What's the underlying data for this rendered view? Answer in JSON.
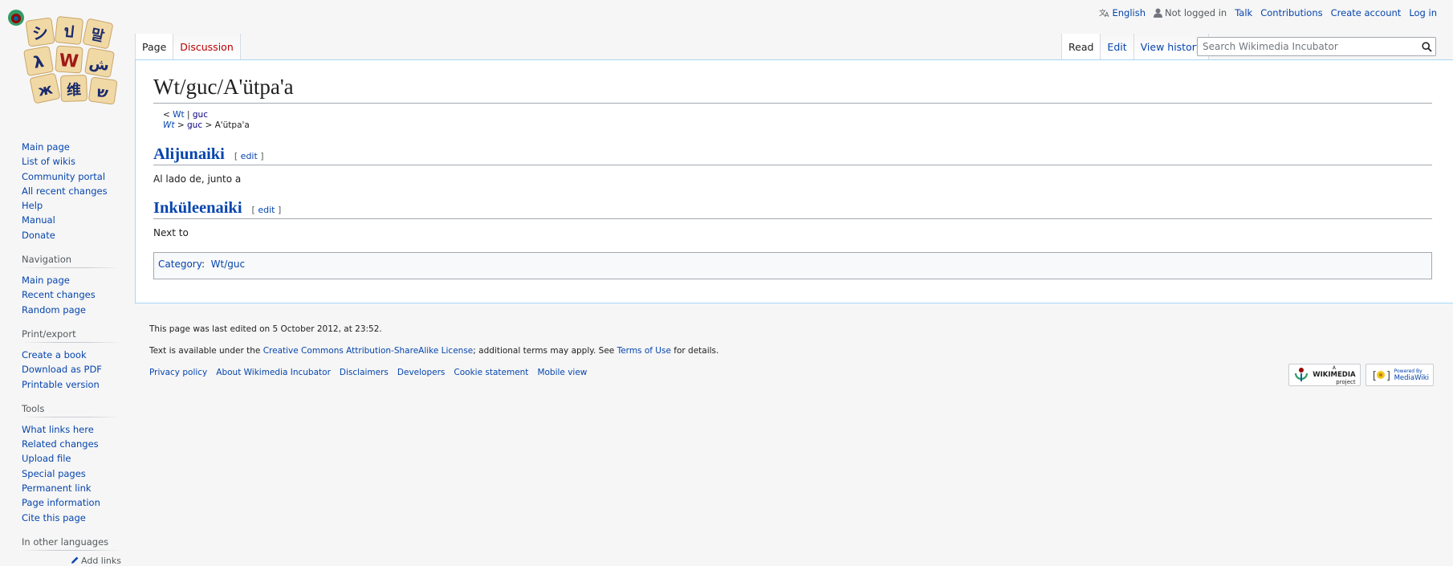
{
  "personal": {
    "language": "English",
    "not_logged_in": "Not logged in",
    "talk": "Talk",
    "contributions": "Contributions",
    "create_account": "Create account",
    "log_in": "Log in"
  },
  "tabs": {
    "page": "Page",
    "discussion": "Discussion",
    "read": "Read",
    "edit": "Edit",
    "view_history": "View history"
  },
  "search": {
    "placeholder": "Search Wikimedia Incubator"
  },
  "sidebar": {
    "main": [
      "Main page",
      "List of wikis",
      "Community portal",
      "All recent changes",
      "Help",
      "Manual",
      "Donate"
    ],
    "navigation": {
      "heading": "Navigation",
      "items": [
        "Main page",
        "Recent changes",
        "Random page"
      ]
    },
    "print": {
      "heading": "Print/export",
      "items": [
        "Create a book",
        "Download as PDF",
        "Printable version"
      ]
    },
    "tools": {
      "heading": "Tools",
      "items": [
        "What links here",
        "Related changes",
        "Upload file",
        "Special pages",
        "Permanent link",
        "Page information",
        "Cite this page"
      ]
    },
    "languages": {
      "heading": "In other languages",
      "add_links": "Add links"
    }
  },
  "content": {
    "title": "Wt/guc/A'ütpa'a",
    "subnav1": {
      "lt": "<",
      "wt": "Wt",
      "sep": "|",
      "guc": "guc"
    },
    "subnav2": {
      "wt": "Wt",
      "gt1": ">",
      "guc": "guc",
      "rest": "> A'ütpa'a"
    },
    "sections": [
      {
        "heading": "Alijunaiki",
        "edit": "edit",
        "text": "Al lado de, junto a"
      },
      {
        "heading": "Inküleenaiki",
        "edit": "edit",
        "text": "Next to"
      }
    ],
    "category": {
      "label": "Category",
      "colon": ":",
      "value": "Wt/guc"
    }
  },
  "footer": {
    "last_edited": "This page was last edited on 5 October 2012, at 23:52.",
    "license_pre": "Text is available under the ",
    "license_link": "Creative Commons Attribution-ShareAlike License",
    "license_mid": "; additional terms may apply. See ",
    "terms_link": "Terms of Use",
    "license_post": " for details.",
    "places": [
      "Privacy policy",
      "About Wikimedia Incubator",
      "Disclaimers",
      "Developers",
      "Cookie statement",
      "Mobile view"
    ],
    "wikimedia_badge": [
      "A",
      "WIKIMEDIA",
      "project"
    ],
    "mediawiki_badge": [
      "Powered By",
      "MediaWiki"
    ]
  },
  "colors": {
    "link": "#0645ad",
    "new_link": "#ba0000",
    "content_border": "#a7d7f9"
  }
}
